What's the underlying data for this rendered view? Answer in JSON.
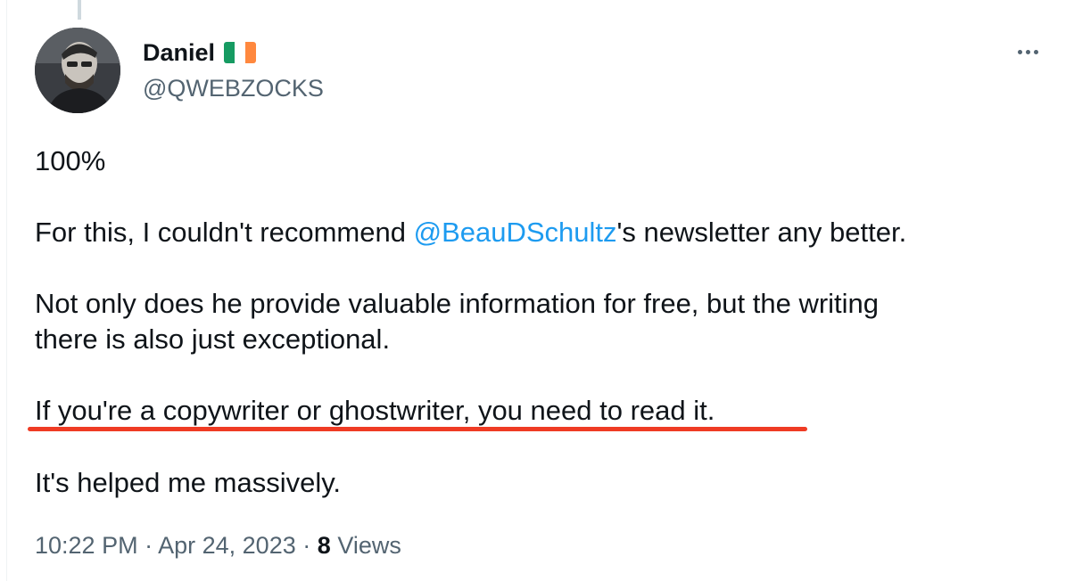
{
  "author": {
    "display_name": "Daniel",
    "flag_icon": "ireland-flag-icon",
    "flag_colors": [
      "#169b62",
      "#ffffff",
      "#ff883e"
    ],
    "handle": "@QWEBZOCKS"
  },
  "tweet": {
    "line1": "100%",
    "line2_before": "For this, I couldn't recommend ",
    "line2_mention": "@BeauDSchultz",
    "line2_after": "'s newsletter any better.",
    "line3": "Not only does he provide valuable information for free, but the writing",
    "line4": "there is also just exceptional.",
    "line5": "If you're a copywriter or ghostwriter, you need to read it.",
    "line6": "It's helped me massively."
  },
  "meta": {
    "time": "10:22 PM",
    "separator": "·",
    "date": "Apr 24, 2023",
    "views_count": "8",
    "views_label": "Views"
  },
  "colors": {
    "mention": "#1d9bf0",
    "secondary_text": "#536471",
    "highlight_underline": "#ef3b24"
  },
  "icons": {
    "more": "more-horizontal-icon"
  }
}
